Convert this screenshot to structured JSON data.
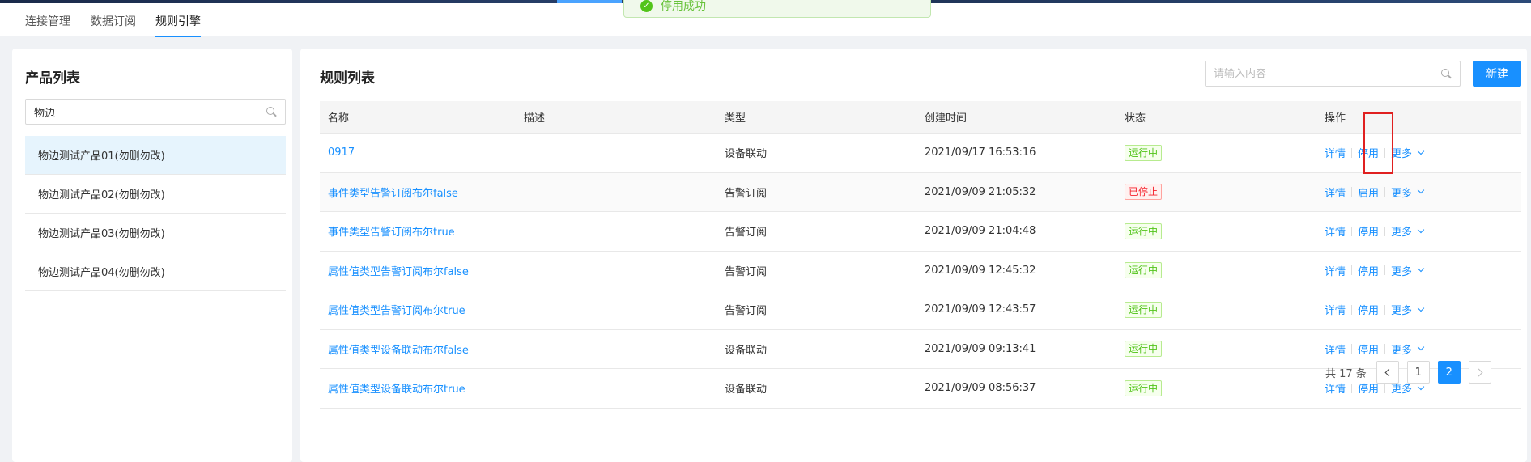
{
  "tabs": [
    {
      "label": "连接管理",
      "active": false
    },
    {
      "label": "数据订阅",
      "active": false
    },
    {
      "label": "规则引擎",
      "active": true
    }
  ],
  "toast": {
    "message": "停用成功"
  },
  "product_panel": {
    "title": "产品列表",
    "search_value": "物边",
    "items": [
      {
        "label": "物边测试产品01(勿删勿改)",
        "selected": true
      },
      {
        "label": "物边测试产品02(勿删勿改)",
        "selected": false
      },
      {
        "label": "物边测试产品03(勿删勿改)",
        "selected": false
      },
      {
        "label": "物边测试产品04(勿删勿改)",
        "selected": false
      }
    ]
  },
  "rule_panel": {
    "title": "规则列表",
    "search_placeholder": "请输入内容",
    "new_button": "新建",
    "columns": [
      "名称",
      "描述",
      "类型",
      "创建时间",
      "状态",
      "操作"
    ],
    "rows": [
      {
        "name": "0917",
        "desc": "",
        "type": "设备联动",
        "created": "2021/09/17 16:53:16",
        "status": "运行中",
        "status_kind": "run",
        "op_detail": "详情",
        "op_toggle": "停用",
        "op_more": "更多"
      },
      {
        "name": "事件类型告警订阅布尔false",
        "desc": "",
        "type": "告警订阅",
        "created": "2021/09/09 21:05:32",
        "status": "已停止",
        "status_kind": "stop",
        "op_detail": "详情",
        "op_toggle": "启用",
        "op_more": "更多"
      },
      {
        "name": "事件类型告警订阅布尔true",
        "desc": "",
        "type": "告警订阅",
        "created": "2021/09/09 21:04:48",
        "status": "运行中",
        "status_kind": "run",
        "op_detail": "详情",
        "op_toggle": "停用",
        "op_more": "更多"
      },
      {
        "name": "属性值类型告警订阅布尔false",
        "desc": "",
        "type": "告警订阅",
        "created": "2021/09/09 12:45:32",
        "status": "运行中",
        "status_kind": "run",
        "op_detail": "详情",
        "op_toggle": "停用",
        "op_more": "更多"
      },
      {
        "name": "属性值类型告警订阅布尔true",
        "desc": "",
        "type": "告警订阅",
        "created": "2021/09/09 12:43:57",
        "status": "运行中",
        "status_kind": "run",
        "op_detail": "详情",
        "op_toggle": "停用",
        "op_more": "更多"
      },
      {
        "name": "属性值类型设备联动布尔false",
        "desc": "",
        "type": "设备联动",
        "created": "2021/09/09 09:13:41",
        "status": "运行中",
        "status_kind": "run",
        "op_detail": "详情",
        "op_toggle": "停用",
        "op_more": "更多"
      },
      {
        "name": "属性值类型设备联动布尔true",
        "desc": "",
        "type": "设备联动",
        "created": "2021/09/09 08:56:37",
        "status": "运行中",
        "status_kind": "run",
        "op_detail": "详情",
        "op_toggle": "停用",
        "op_more": "更多"
      }
    ]
  },
  "pagination": {
    "total_text": "共 17 条",
    "pages": [
      "1",
      "2"
    ],
    "current": "2"
  },
  "colors": {
    "accent": "#1890ff",
    "running": "#52c41a",
    "stopped": "#f5222d",
    "highlight": "#e02020"
  },
  "icons": [
    "search-icon",
    "check-circle-icon",
    "chevron-down-icon",
    "chevron-left-icon",
    "chevron-right-icon"
  ]
}
